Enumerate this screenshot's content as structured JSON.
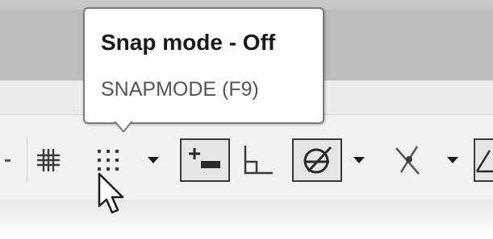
{
  "tooltip": {
    "title": "Snap mode - Off",
    "command": "SNAPMODE (F9)"
  },
  "statusbar": {
    "tools": [
      {
        "icon": "grid-icon",
        "state": "off"
      },
      {
        "icon": "snap-mode-icon",
        "state": "off"
      },
      {
        "icon": "chevron-down-icon"
      },
      {
        "icon": "dynamic-input-icon",
        "state": "on"
      },
      {
        "icon": "ortho-mode-icon",
        "state": "off"
      },
      {
        "icon": "polar-tracking-icon",
        "state": "on"
      },
      {
        "icon": "chevron-down-icon"
      },
      {
        "icon": "isometric-drafting-icon",
        "state": "off"
      },
      {
        "icon": "chevron-down-icon"
      },
      {
        "icon": "object-snap-tracking-icon",
        "state": "off"
      }
    ]
  },
  "colors": {
    "icon": "#3a3a3a",
    "statusbar_bg": "#f2f2f2",
    "header_bg": "#bdbdbd"
  }
}
